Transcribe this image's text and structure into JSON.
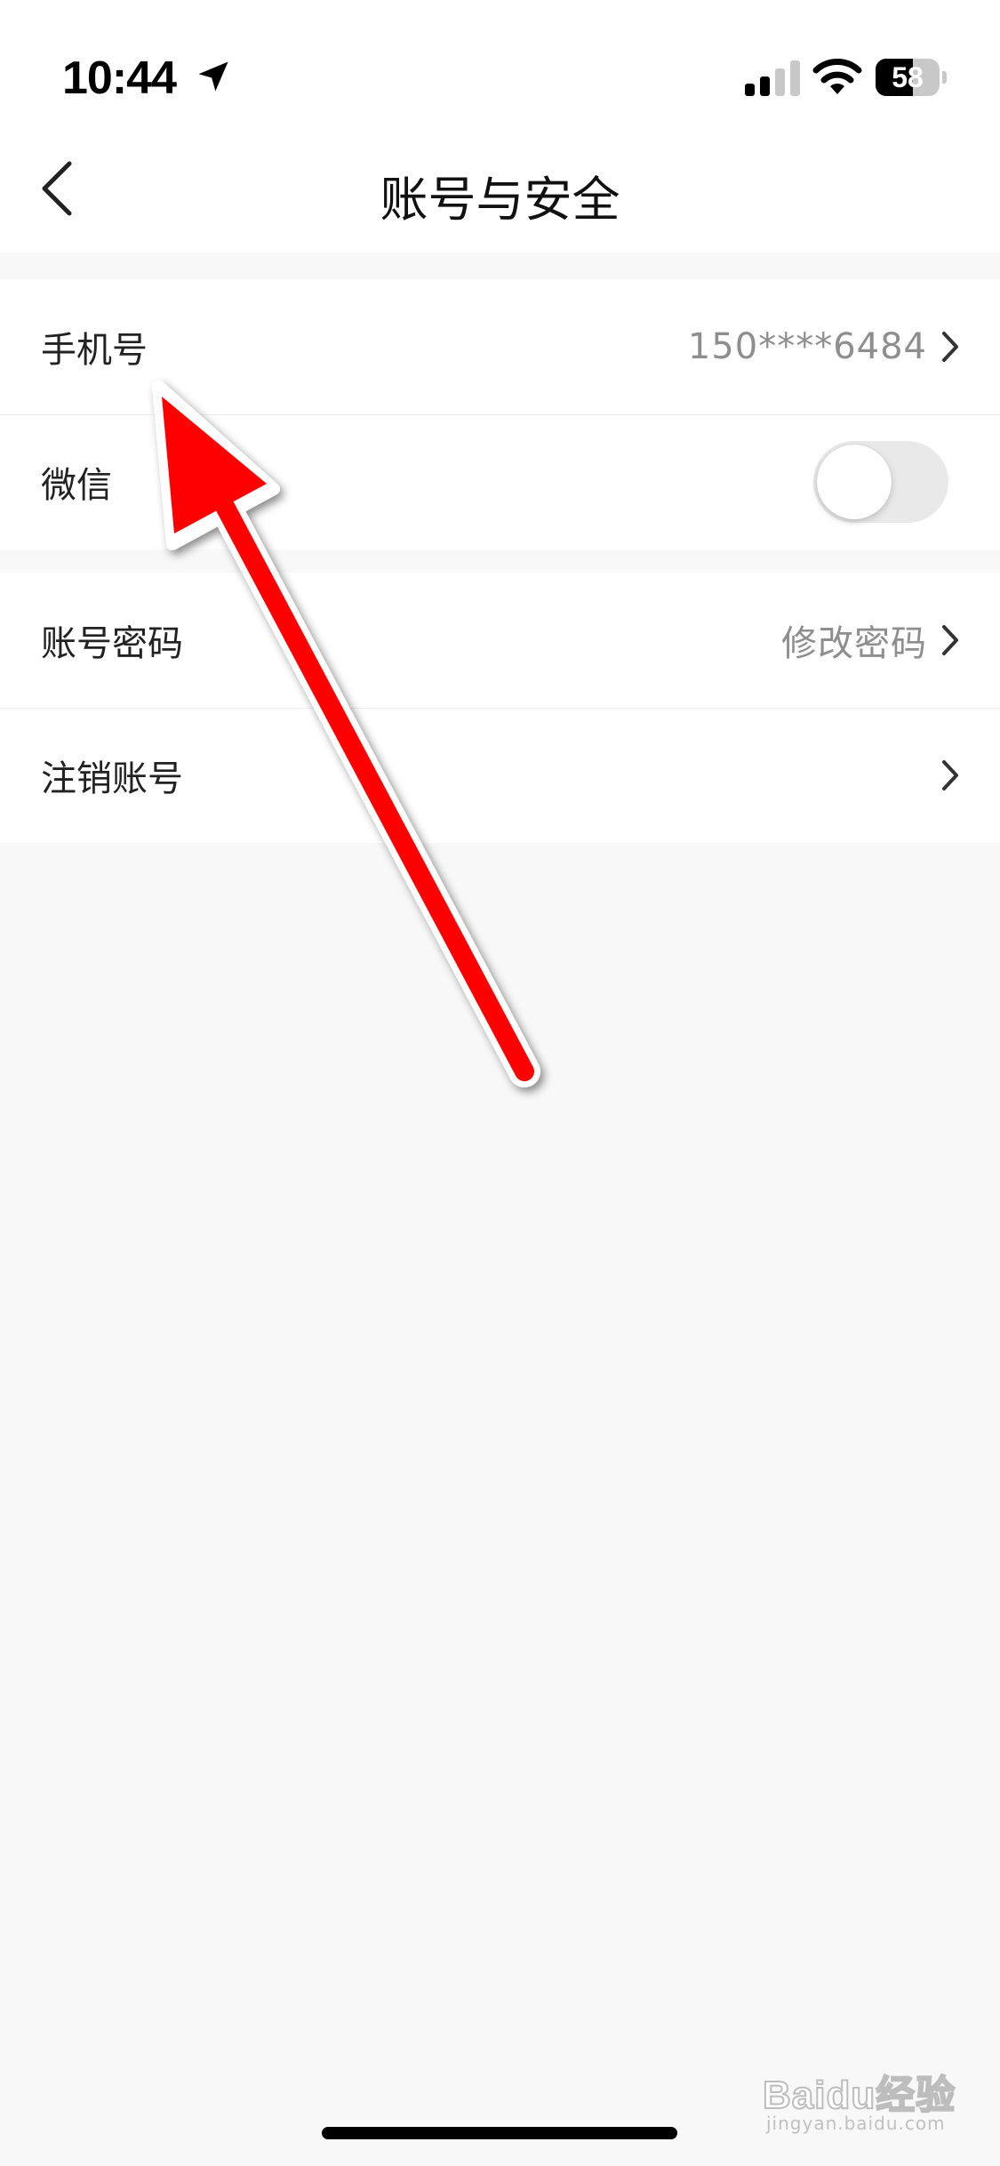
{
  "status_bar": {
    "time": "10:44",
    "battery_level": "58"
  },
  "nav": {
    "title": "账号与安全"
  },
  "groups": [
    {
      "rows": [
        {
          "label": "手机号",
          "value": "150****6484"
        },
        {
          "label": "微信",
          "toggle_on": false
        }
      ]
    },
    {
      "rows": [
        {
          "label": "账号密码",
          "value": "修改密码"
        },
        {
          "label": "注销账号"
        }
      ]
    }
  ],
  "watermark": {
    "brand": "Baidu经验",
    "sub": "jingyan.baidu.com"
  },
  "colors": {
    "arrow": "#ff0000",
    "secondary_text": "#8e8e8e",
    "toggle_off": "#e9e9ea"
  }
}
